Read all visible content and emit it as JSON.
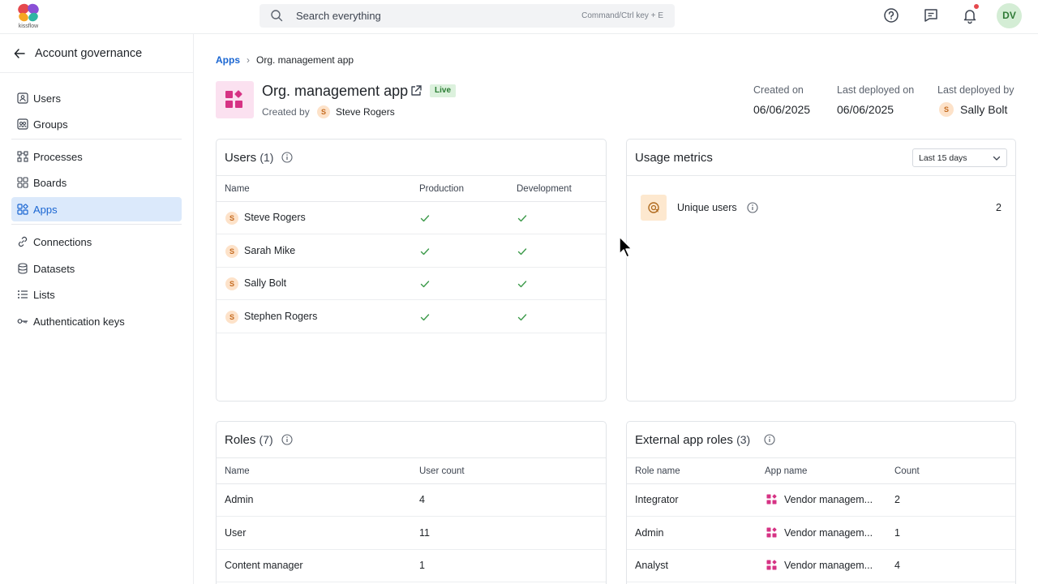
{
  "brand": {
    "logo_text": "kissflow"
  },
  "search": {
    "placeholder": "Search everything",
    "hint": "Command/Ctrl key + E"
  },
  "user": {
    "initials": "DV"
  },
  "sidebar": {
    "title": "Account governance",
    "groups": [
      [
        {
          "label": "Users",
          "icon": "user-icon"
        },
        {
          "label": "Groups",
          "icon": "groups-icon"
        }
      ],
      [
        {
          "label": "Processes",
          "icon": "processes-icon"
        },
        {
          "label": "Boards",
          "icon": "boards-icon"
        },
        {
          "label": "Apps",
          "icon": "apps-icon",
          "active": true
        }
      ],
      [
        {
          "label": "Connections",
          "icon": "connections-icon"
        },
        {
          "label": "Datasets",
          "icon": "datasets-icon"
        },
        {
          "label": "Lists",
          "icon": "lists-icon"
        },
        {
          "label": "Authentication keys",
          "icon": "key-icon"
        }
      ]
    ]
  },
  "breadcrumb": {
    "parent": "Apps",
    "current": "Org. management app"
  },
  "app": {
    "title": "Org. management app",
    "status": "Live",
    "created_by_label": "Created by",
    "created_by": "Steve Rogers",
    "created_by_initial": "S",
    "created_on_label": "Created on",
    "created_on": "06/06/2025",
    "last_deployed_on_label": "Last deployed on",
    "last_deployed_on": "06/06/2025",
    "last_deployed_by_label": "Last deployed by",
    "last_deployed_by": "Sally Bolt",
    "last_deployed_by_initial": "S"
  },
  "users_card": {
    "title": "Users",
    "count": "(1)",
    "columns": [
      "Name",
      "Production",
      "Development"
    ],
    "rows": [
      {
        "initial": "S",
        "name": "Steve Rogers",
        "production": true,
        "development": true
      },
      {
        "initial": "S",
        "name": "Sarah Mike",
        "production": true,
        "development": true
      },
      {
        "initial": "S",
        "name": "Sally Bolt",
        "production": true,
        "development": true
      },
      {
        "initial": "S",
        "name": "Stephen Rogers",
        "production": true,
        "development": true
      }
    ]
  },
  "usage_card": {
    "title": "Usage metrics",
    "range": "Last 15 days",
    "metric_label": "Unique users",
    "metric_value": "2"
  },
  "roles_card": {
    "title": "Roles",
    "count": "(7)",
    "columns": [
      "Name",
      "User count"
    ],
    "rows": [
      {
        "name": "Admin",
        "count": "4"
      },
      {
        "name": "User",
        "count": "11"
      },
      {
        "name": "Content manager",
        "count": "1"
      }
    ]
  },
  "ext_roles_card": {
    "title": "External app roles",
    "count": "(3)",
    "columns": [
      "Role name",
      "App name",
      "Count"
    ],
    "rows": [
      {
        "role": "Integrator",
        "app": "Vendor managem...",
        "count": "2"
      },
      {
        "role": "Admin",
        "app": "Vendor managem...",
        "count": "1"
      },
      {
        "role": "Analyst",
        "app": "Vendor managem...",
        "count": "4"
      }
    ]
  },
  "colors": {
    "accent": "#1a66d2",
    "app_pink": "#d63384",
    "check": "#3c9a4a"
  }
}
